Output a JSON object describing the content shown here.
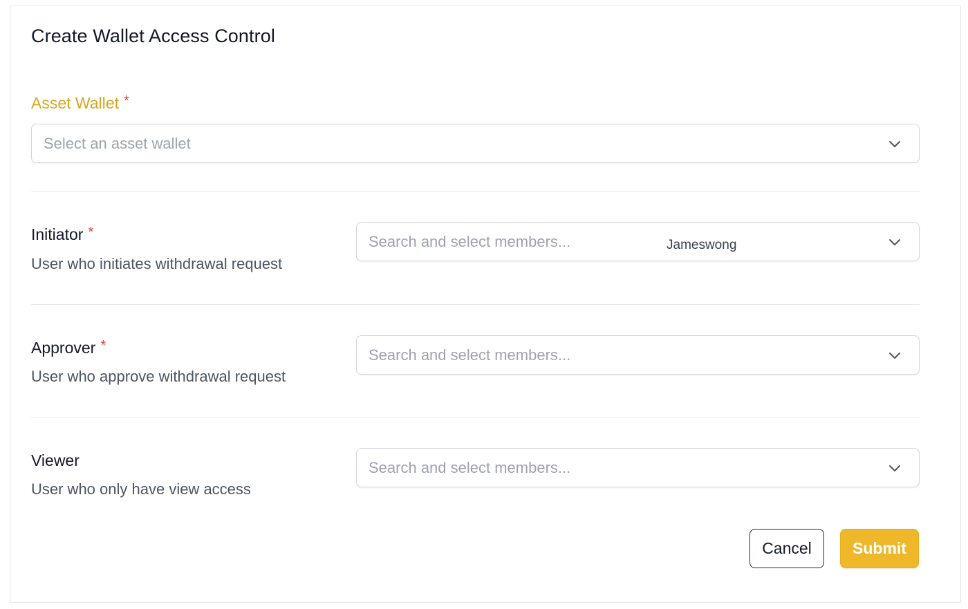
{
  "form": {
    "title": "Create Wallet Access Control",
    "accent_color": "#d9a521",
    "required_marker": "*",
    "asset_wallet": {
      "label": "Asset Wallet",
      "placeholder": "Select an asset wallet"
    },
    "initiator": {
      "label": "Initiator",
      "description": "User who initiates withdrawal request",
      "placeholder": "Search and select members...",
      "selected_value": "Jameswong"
    },
    "approver": {
      "label": "Approver",
      "description": "User who approve withdrawal request",
      "placeholder": "Search and select members..."
    },
    "viewer": {
      "label": "Viewer",
      "description": "User who only have view access",
      "placeholder": "Search and select members..."
    }
  },
  "actions": {
    "cancel_label": "Cancel",
    "submit_label": "Submit",
    "submit_color": "#efb82a"
  },
  "icons": {
    "dropdown": "chevron-down-icon"
  }
}
